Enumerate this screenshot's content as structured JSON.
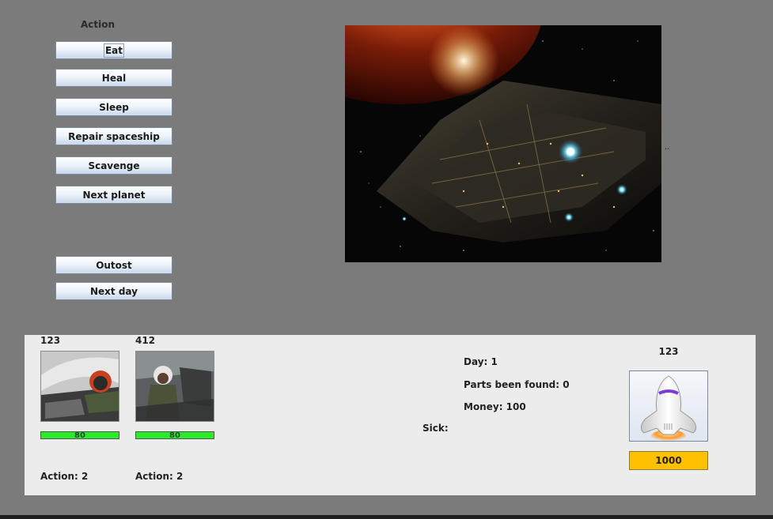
{
  "actions": {
    "title": "Action",
    "buttons": [
      {
        "label": "Eat"
      },
      {
        "label": "Heal"
      },
      {
        "label": "Sleep"
      },
      {
        "label": "Repair spaceship"
      },
      {
        "label": "Scavenge"
      },
      {
        "label": "Next planet"
      }
    ],
    "outpost_label": "Outost",
    "next_day_label": "Next day"
  },
  "scene_marker": "..",
  "crew": [
    {
      "name": "123",
      "health": 80,
      "health_label": "80",
      "action": "Action: 2"
    },
    {
      "name": "412",
      "health": 80,
      "health_label": "80",
      "action": "Action: 2"
    }
  ],
  "status": {
    "day": "Day: 1",
    "parts": "Parts been found: 0",
    "money": "Money: 100",
    "sick": "Sick:"
  },
  "ship": {
    "name": "123",
    "shield": "1000"
  },
  "colors": {
    "health_bar": "#2aeb2a",
    "shield_bar": "#ffc000"
  }
}
